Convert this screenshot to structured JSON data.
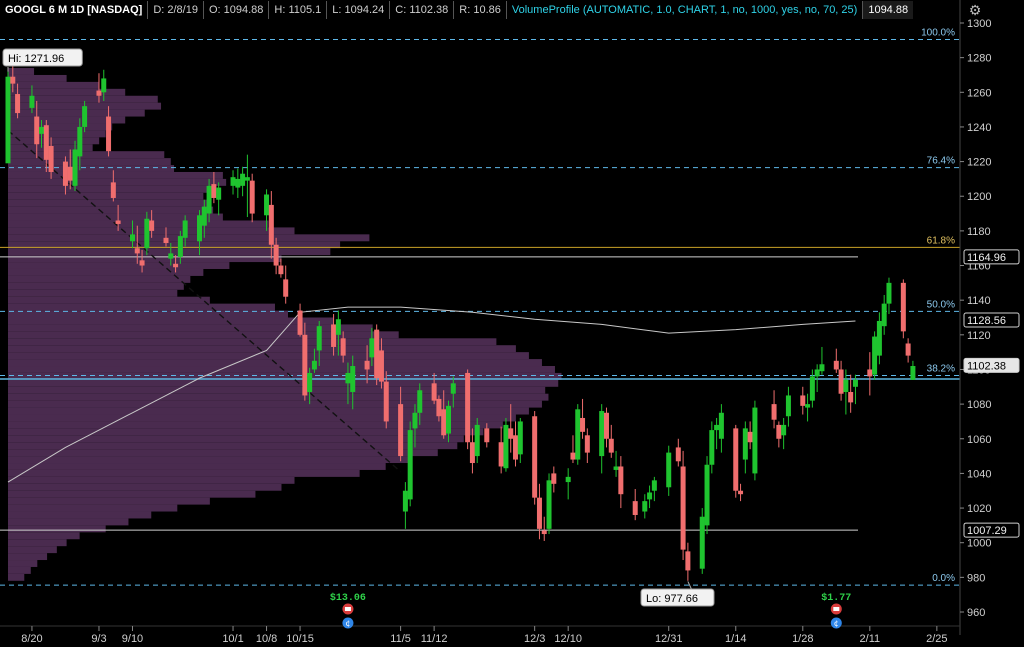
{
  "header": {
    "symbol": "GOOGL 6 M 1D [NASDAQ]",
    "date": "D: 2/8/19",
    "open": "O: 1094.88",
    "high": "H: 1105.1",
    "low": "L: 1094.24",
    "close": "C: 1102.38",
    "range": "R: 10.86",
    "study": "VolumeProfile (AUTOMATIC, 1.0, CHART, 1, no, 1000, yes, no, 70, 25)",
    "study_value": "1094.88"
  },
  "colors": {
    "up": "#1fc42f",
    "down": "#f06e6e",
    "profile": "#4a2b4f",
    "fib": "#5eb8e8",
    "fib618": "#c9a227",
    "sma": "#c8c8c8",
    "trend": "#111111",
    "background": "#000000"
  },
  "chart_data": {
    "type": "candlestick",
    "ylim": [
      950,
      1305
    ],
    "y_ticks": [
      960,
      980,
      1000,
      1020,
      1040,
      1060,
      1080,
      1100,
      1120,
      1140,
      1160,
      1180,
      1200,
      1220,
      1240,
      1260,
      1280,
      1300
    ],
    "x_ticks": [
      {
        "label": "8/20",
        "date": "2018-08-20"
      },
      {
        "label": "9/3",
        "date": "2018-09-03"
      },
      {
        "label": "9/10",
        "date": "2018-09-10"
      },
      {
        "label": "10/1",
        "date": "2018-10-01"
      },
      {
        "label": "10/8",
        "date": "2018-10-08"
      },
      {
        "label": "10/15",
        "date": "2018-10-15"
      },
      {
        "label": "11/5",
        "date": "2018-11-05"
      },
      {
        "label": "11/12",
        "date": "2018-11-12"
      },
      {
        "label": "12/3",
        "date": "2018-12-03"
      },
      {
        "label": "12/10",
        "date": "2018-12-10"
      },
      {
        "label": "12/31",
        "date": "2018-12-31"
      },
      {
        "label": "1/14",
        "date": "2019-01-14"
      },
      {
        "label": "1/28",
        "date": "2019-01-28"
      },
      {
        "label": "2/11",
        "date": "2019-02-11"
      },
      {
        "label": "2/25",
        "date": "2019-02-25"
      }
    ],
    "price_labels": [
      {
        "value": 1164.96,
        "text": "1164.96",
        "style": "outline"
      },
      {
        "value": 1128.56,
        "text": "1128.56",
        "style": "outline"
      },
      {
        "value": 1102.38,
        "text": "1102.38",
        "style": "filled"
      },
      {
        "value": 1007.29,
        "text": "1007.29",
        "style": "outline"
      }
    ],
    "fib_levels": [
      {
        "pct": "100.0%",
        "value": 1290.5,
        "type": "dashed"
      },
      {
        "pct": "76.4%",
        "value": 1216.5,
        "type": "dashed"
      },
      {
        "pct": "61.8%",
        "value": 1170.5,
        "type": "solid"
      },
      {
        "pct": "50.0%",
        "value": 1133.5,
        "type": "dashed"
      },
      {
        "pct": "38.2%",
        "value": 1096.5,
        "type": "dashed"
      },
      {
        "pct": "0.0%",
        "value": 975.5,
        "type": "dashed"
      }
    ],
    "value_area_lines": [
      1164.96,
      1007.29
    ],
    "hi_label": {
      "text": "Hi: 1271.96",
      "value": 1271.96
    },
    "lo_label": {
      "text": "Lo: 977.66",
      "value": 977.66
    },
    "events": [
      {
        "label": "$13.06",
        "date": "2018-10-25"
      },
      {
        "label": "$1.77",
        "date": "2019-02-04"
      }
    ],
    "sma": [
      [
        "2018-08-15",
        1035
      ],
      [
        "2018-08-27",
        1055
      ],
      [
        "2018-09-10",
        1075
      ],
      [
        "2018-09-24",
        1095
      ],
      [
        "2018-10-08",
        1111
      ],
      [
        "2018-10-15",
        1133
      ],
      [
        "2018-10-25",
        1136
      ],
      [
        "2018-11-05",
        1136
      ],
      [
        "2018-11-20",
        1133
      ],
      [
        "2018-12-03",
        1129
      ],
      [
        "2018-12-17",
        1126
      ],
      [
        "2018-12-31",
        1121
      ],
      [
        "2019-01-14",
        1123
      ],
      [
        "2019-01-28",
        1126
      ],
      [
        "2019-02-08",
        1128
      ]
    ],
    "trendline": [
      [
        "2018-08-15",
        1238
      ],
      [
        "2018-11-05",
        1041
      ]
    ],
    "volume_profile": [
      [
        1272,
        40
      ],
      [
        1268,
        90
      ],
      [
        1264,
        140
      ],
      [
        1260,
        180
      ],
      [
        1256,
        230
      ],
      [
        1252,
        235
      ],
      [
        1248,
        210
      ],
      [
        1244,
        180
      ],
      [
        1240,
        160
      ],
      [
        1236,
        150
      ],
      [
        1232,
        140
      ],
      [
        1228,
        130
      ],
      [
        1224,
        240
      ],
      [
        1220,
        250
      ],
      [
        1216,
        255
      ],
      [
        1212,
        330
      ],
      [
        1208,
        335
      ],
      [
        1204,
        320
      ],
      [
        1200,
        300
      ],
      [
        1196,
        310
      ],
      [
        1192,
        315
      ],
      [
        1188,
        330
      ],
      [
        1184,
        400
      ],
      [
        1180,
        440
      ],
      [
        1176,
        555
      ],
      [
        1172,
        510
      ],
      [
        1168,
        495
      ],
      [
        1164,
        420
      ],
      [
        1160,
        340
      ],
      [
        1156,
        300
      ],
      [
        1152,
        280
      ],
      [
        1148,
        270
      ],
      [
        1144,
        260
      ],
      [
        1140,
        310
      ],
      [
        1136,
        410
      ],
      [
        1132,
        430
      ],
      [
        1128,
        500
      ],
      [
        1124,
        560
      ],
      [
        1120,
        600
      ],
      [
        1116,
        750
      ],
      [
        1112,
        780
      ],
      [
        1108,
        800
      ],
      [
        1104,
        820
      ],
      [
        1100,
        840
      ],
      [
        1096,
        850
      ],
      [
        1092,
        845
      ],
      [
        1088,
        825
      ],
      [
        1084,
        830
      ],
      [
        1080,
        820
      ],
      [
        1076,
        800
      ],
      [
        1072,
        780
      ],
      [
        1068,
        760
      ],
      [
        1064,
        730
      ],
      [
        1060,
        700
      ],
      [
        1056,
        690
      ],
      [
        1052,
        660
      ],
      [
        1048,
        620
      ],
      [
        1044,
        580
      ],
      [
        1040,
        540
      ],
      [
        1036,
        440
      ],
      [
        1032,
        420
      ],
      [
        1028,
        380
      ],
      [
        1024,
        310
      ],
      [
        1020,
        260
      ],
      [
        1016,
        220
      ],
      [
        1012,
        185
      ],
      [
        1008,
        150
      ],
      [
        1004,
        110
      ],
      [
        1000,
        90
      ],
      [
        996,
        75
      ],
      [
        992,
        60
      ],
      [
        988,
        45
      ],
      [
        984,
        35
      ],
      [
        980,
        25
      ]
    ],
    "candles": [
      [
        "2018-08-15",
        1219,
        1273,
        1236,
        1269
      ],
      [
        "2018-08-16",
        1269,
        1276,
        1260,
        1265
      ],
      [
        "2018-08-17",
        1259,
        1265,
        1245,
        1248
      ],
      [
        "2018-08-20",
        1251,
        1264,
        1248,
        1258
      ],
      [
        "2018-08-21",
        1246,
        1255,
        1222,
        1230
      ],
      [
        "2018-08-22",
        1236,
        1244,
        1228,
        1240
      ],
      [
        "2018-08-23",
        1241,
        1244,
        1214,
        1221
      ],
      [
        "2018-08-24",
        1229,
        1234,
        1210,
        1214
      ],
      [
        "2018-08-27",
        1220,
        1223,
        1201,
        1206
      ],
      [
        "2018-08-28",
        1217,
        1227,
        1204,
        1209
      ],
      [
        "2018-08-29",
        1206,
        1232,
        1203,
        1227
      ],
      [
        "2018-08-30",
        1223,
        1245,
        1215,
        1240
      ],
      [
        "2018-08-31",
        1240,
        1255,
        1237,
        1252
      ],
      [
        "2018-09-03",
        1261,
        1271,
        1254,
        1258
      ],
      [
        "2018-09-04",
        1260,
        1273,
        1255,
        1268
      ],
      [
        "2018-09-05",
        1246,
        1252,
        1223,
        1226
      ],
      [
        "2018-09-06",
        1208,
        1215,
        1197,
        1199
      ],
      [
        "2018-09-07",
        1186,
        1195,
        1180,
        1184
      ],
      [
        "2018-09-10",
        1174,
        1186,
        1170,
        1178
      ],
      [
        "2018-09-11",
        1170,
        1183,
        1161,
        1167
      ],
      [
        "2018-09-12",
        1163,
        1169,
        1156,
        1160
      ],
      [
        "2018-09-13",
        1170,
        1191,
        1166,
        1187
      ],
      [
        "2018-09-14",
        1186,
        1192,
        1176,
        1180
      ],
      [
        "2018-09-17",
        1176,
        1182,
        1171,
        1173
      ],
      [
        "2018-09-18",
        1164,
        1173,
        1160,
        1167
      ],
      [
        "2018-09-19",
        1161,
        1166,
        1156,
        1159
      ],
      [
        "2018-09-20",
        1165,
        1180,
        1161,
        1177
      ],
      [
        "2018-09-21",
        1176,
        1189,
        1171,
        1186
      ],
      [
        "2018-09-24",
        1174,
        1192,
        1166,
        1189
      ],
      [
        "2018-09-25",
        1183,
        1198,
        1176,
        1194
      ],
      [
        "2018-09-26",
        1190,
        1210,
        1185,
        1206
      ],
      [
        "2018-09-27",
        1207,
        1214,
        1196,
        1199
      ],
      [
        "2018-09-28",
        1198,
        1208,
        1189,
        1205
      ],
      [
        "2018-10-01",
        1206,
        1215,
        1201,
        1211
      ],
      [
        "2018-10-02",
        1205,
        1216,
        1199,
        1210
      ],
      [
        "2018-10-03",
        1206,
        1217,
        1200,
        1213
      ],
      [
        "2018-10-04",
        1209,
        1224,
        1188,
        1211
      ],
      [
        "2018-10-05",
        1209,
        1213,
        1185,
        1190
      ],
      [
        "2018-10-08",
        1189,
        1204,
        1180,
        1201
      ],
      [
        "2018-10-09",
        1195,
        1203,
        1164,
        1172
      ],
      [
        "2018-10-10",
        1172,
        1176,
        1155,
        1160
      ],
      [
        "2018-10-11",
        1160,
        1164,
        1153,
        1155
      ],
      [
        "2018-10-12",
        1152,
        1160,
        1138,
        1142
      ],
      [
        "2018-10-15",
        1134,
        1138,
        1119,
        1120
      ],
      [
        "2018-10-16",
        1120,
        1127,
        1082,
        1085
      ],
      [
        "2018-10-17",
        1087,
        1101,
        1080,
        1098
      ],
      [
        "2018-10-18",
        1100,
        1112,
        1098,
        1105
      ],
      [
        "2018-10-19",
        1111,
        1128,
        1102,
        1125
      ],
      [
        "2018-10-22",
        1126,
        1132,
        1108,
        1113
      ],
      [
        "2018-10-23",
        1120,
        1134,
        1108,
        1129
      ],
      [
        "2018-10-24",
        1118,
        1122,
        1104,
        1108
      ],
      [
        "2018-10-25",
        1092,
        1104,
        1080,
        1098
      ],
      [
        "2018-10-26",
        1087,
        1108,
        1077,
        1102
      ],
      [
        "2018-10-29",
        1105,
        1114,
        1092,
        1100
      ],
      [
        "2018-10-30",
        1107,
        1124,
        1102,
        1118
      ],
      [
        "2018-10-31",
        1123,
        1126,
        1091,
        1095
      ],
      [
        "2018-11-01",
        1111,
        1118,
        1089,
        1093
      ],
      [
        "2018-11-02",
        1093,
        1099,
        1066,
        1070
      ],
      [
        "2018-11-05",
        1080,
        1090,
        1047,
        1050
      ],
      [
        "2018-11-06",
        1018,
        1035,
        1008,
        1030
      ],
      [
        "2018-11-07",
        1025,
        1070,
        1021,
        1065
      ],
      [
        "2018-11-08",
        1066,
        1080,
        1055,
        1075
      ],
      [
        "2018-11-09",
        1075,
        1092,
        1068,
        1088
      ],
      [
        "2018-11-12",
        1092,
        1098,
        1080,
        1082
      ],
      [
        "2018-11-13",
        1083,
        1085,
        1070,
        1073
      ],
      [
        "2018-11-14",
        1077,
        1088,
        1060,
        1062
      ],
      [
        "2018-11-15",
        1063,
        1082,
        1058,
        1079
      ],
      [
        "2018-11-16",
        1086,
        1096,
        1078,
        1092
      ],
      [
        "2018-11-19",
        1098,
        1100,
        1054,
        1058
      ],
      [
        "2018-11-20",
        1058,
        1066,
        1040,
        1046
      ],
      [
        "2018-11-21",
        1050,
        1072,
        1046,
        1068
      ],
      [
        "2018-11-23",
        1066,
        1069,
        1055,
        1058
      ],
      [
        "2018-11-26",
        1058,
        1067,
        1040,
        1044
      ],
      [
        "2018-11-27",
        1043,
        1072,
        1041,
        1068
      ],
      [
        "2018-11-28",
        1066,
        1080,
        1052,
        1060
      ],
      [
        "2018-11-29",
        1062,
        1070,
        1044,
        1048
      ],
      [
        "2018-11-30",
        1051,
        1072,
        1046,
        1070
      ],
      [
        "2018-12-03",
        1073,
        1076,
        1022,
        1026
      ],
      [
        "2018-12-04",
        1026,
        1034,
        1002,
        1008
      ],
      [
        "2018-12-05",
        1007,
        1015,
        1001,
        1005
      ],
      [
        "2018-12-06",
        1008,
        1040,
        1005,
        1036
      ],
      [
        "2018-12-07",
        1040,
        1044,
        1029,
        1034
      ],
      [
        "2018-12-10",
        1035,
        1043,
        1025,
        1038
      ],
      [
        "2018-12-11",
        1052,
        1062,
        1046,
        1048
      ],
      [
        "2018-12-12",
        1048,
        1080,
        1045,
        1077
      ],
      [
        "2018-12-13",
        1072,
        1083,
        1060,
        1064
      ],
      [
        "2018-12-14",
        1062,
        1066,
        1046,
        1052
      ],
      [
        "2018-12-17",
        1050,
        1080,
        1040,
        1076
      ],
      [
        "2018-12-18",
        1075,
        1078,
        1055,
        1060
      ],
      [
        "2018-12-19",
        1060,
        1068,
        1049,
        1052
      ],
      [
        "2018-12-20",
        1042,
        1053,
        1038,
        1044
      ],
      [
        "2018-12-21",
        1044,
        1050,
        1020,
        1028
      ],
      [
        "2018-12-24",
        1024,
        1031,
        1013,
        1016
      ],
      [
        "2018-12-26",
        1018,
        1028,
        1014,
        1024
      ],
      [
        "2018-12-27",
        1025,
        1033,
        1020,
        1029
      ],
      [
        "2018-12-28",
        1030,
        1038,
        1024,
        1036
      ],
      [
        "2018-12-31",
        1032,
        1056,
        1027,
        1052
      ],
      [
        "2019-01-02",
        1055,
        1060,
        1044,
        1047
      ],
      [
        "2019-01-03",
        1044,
        1053,
        990,
        996
      ],
      [
        "2019-01-04",
        995,
        1000,
        978,
        984
      ],
      [
        "2019-01-07",
        985,
        1020,
        982,
        1015
      ],
      [
        "2019-01-08",
        1010,
        1050,
        1005,
        1045
      ],
      [
        "2019-01-09",
        1045,
        1070,
        1040,
        1065
      ],
      [
        "2019-01-10",
        1065,
        1072,
        1054,
        1068
      ],
      [
        "2019-01-11",
        1060,
        1080,
        1052,
        1075
      ],
      [
        "2019-01-14",
        1066,
        1068,
        1026,
        1030
      ],
      [
        "2019-01-15",
        1030,
        1034,
        1024,
        1028
      ],
      [
        "2019-01-16",
        1048,
        1070,
        1040,
        1066
      ],
      [
        "2019-01-17",
        1064,
        1070,
        1054,
        1058
      ],
      [
        "2019-01-18",
        1040,
        1082,
        1036,
        1078
      ],
      [
        "2019-01-22",
        1080,
        1088,
        1066,
        1071
      ],
      [
        "2019-01-23",
        1068,
        1070,
        1055,
        1060
      ],
      [
        "2019-01-24",
        1062,
        1072,
        1054,
        1068
      ],
      [
        "2019-01-25",
        1073,
        1090,
        1067,
        1085
      ],
      [
        "2019-01-28",
        1085,
        1090,
        1074,
        1079
      ],
      [
        "2019-01-29",
        1078,
        1086,
        1070,
        1080
      ],
      [
        "2019-01-30",
        1082,
        1100,
        1078,
        1096
      ],
      [
        "2019-01-31",
        1096,
        1103,
        1087,
        1100
      ],
      [
        "2019-02-01",
        1099,
        1113,
        1097,
        1103
      ],
      [
        "2019-02-04",
        1105,
        1112,
        1098,
        1100
      ],
      [
        "2019-02-05",
        1100,
        1105,
        1082,
        1086
      ],
      [
        "2019-02-06",
        1087,
        1100,
        1074,
        1094
      ],
      [
        "2019-02-07",
        1087,
        1097,
        1075,
        1081
      ],
      [
        "2019-02-08",
        1090,
        1097,
        1080,
        1094
      ],
      [
        "2019-02-11",
        1100,
        1110,
        1085,
        1096
      ],
      [
        "2019-02-12",
        1097,
        1122,
        1094,
        1119
      ],
      [
        "2019-02-13",
        1108,
        1133,
        1103,
        1128
      ],
      [
        "2019-02-14",
        1125,
        1143,
        1120,
        1138
      ],
      [
        "2019-02-15",
        1138,
        1153,
        1132,
        1150
      ],
      [
        "2019-02-18",
        1150,
        1152,
        1118,
        1122
      ],
      [
        "2019-02-19",
        1115,
        1118,
        1104,
        1108
      ],
      [
        "2019-02-20",
        1094,
        1105,
        1094,
        1102
      ]
    ]
  }
}
